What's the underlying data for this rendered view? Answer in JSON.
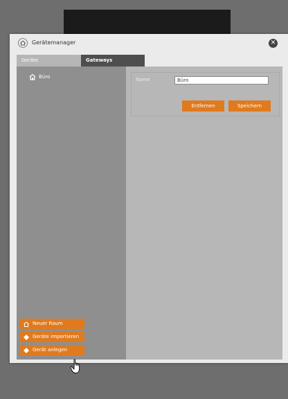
{
  "window": {
    "title": "Gerätemanager",
    "close_icon": "close-icon"
  },
  "tabs": [
    {
      "label": "Geräte",
      "active": true
    },
    {
      "label": "Gateways",
      "active": false
    }
  ],
  "rooms": [
    {
      "label": "Büro",
      "icon": "home-icon"
    }
  ],
  "form": {
    "name_label": "Name",
    "name_value": "Büro",
    "remove_label": "Entfernen",
    "save_label": "Speichern"
  },
  "actions": [
    {
      "label": "Neuer Raum",
      "icon": "home-icon"
    },
    {
      "label": "Geräte importieren",
      "icon": "plus-diamond-icon"
    },
    {
      "label": "Gerät anlegen",
      "icon": "plus-diamond-icon"
    }
  ],
  "colors": {
    "accent": "#e07a1e",
    "left_panel": "#8f8f8f",
    "right_panel": "#b7b7b7"
  }
}
